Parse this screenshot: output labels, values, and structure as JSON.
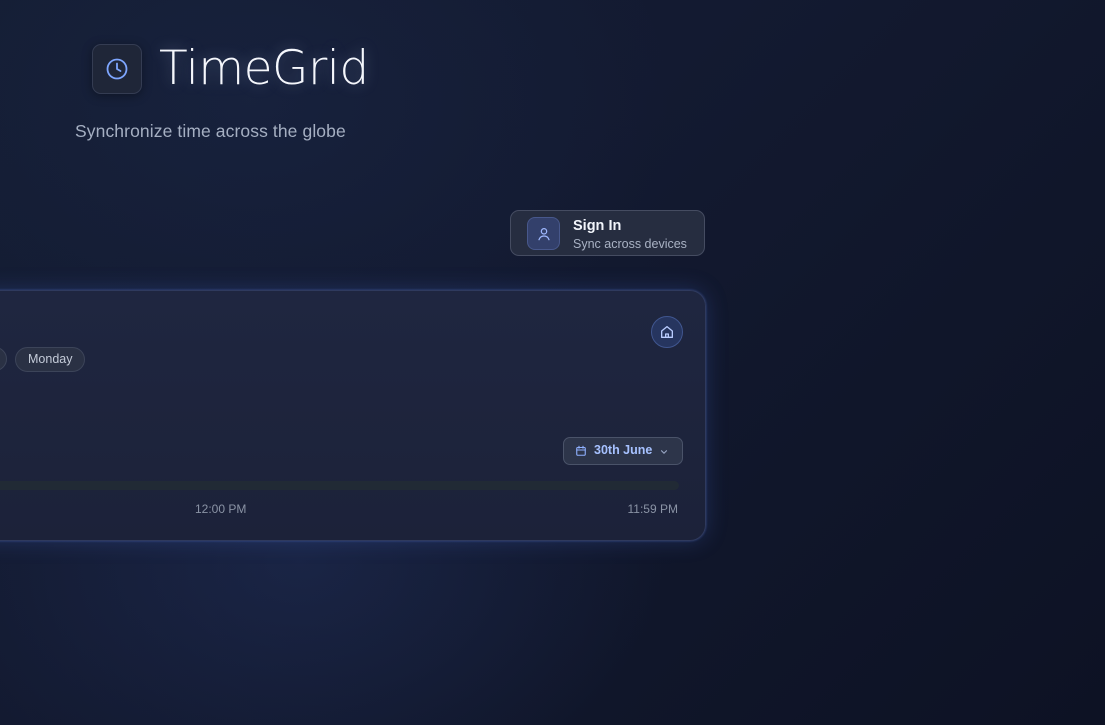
{
  "header": {
    "app_name": "TimeGrid",
    "tagline": "Synchronize time across the globe",
    "logo_icon": "clock-icon"
  },
  "signin": {
    "title": "Sign In",
    "subtitle": "Sync across devices",
    "icon": "user-icon"
  },
  "card": {
    "day_label": "Monday",
    "home_icon": "home-icon",
    "date_picker": {
      "label": "30th June",
      "icon": "calendar-icon",
      "chevron": "chevron-down-icon"
    },
    "timeline": {
      "mid_label": "12:00 PM",
      "end_label": "11:59 PM"
    }
  },
  "colors": {
    "accent": "#a6c1ff",
    "icon_blue": "#7ea6ff",
    "background": "#131a31"
  }
}
